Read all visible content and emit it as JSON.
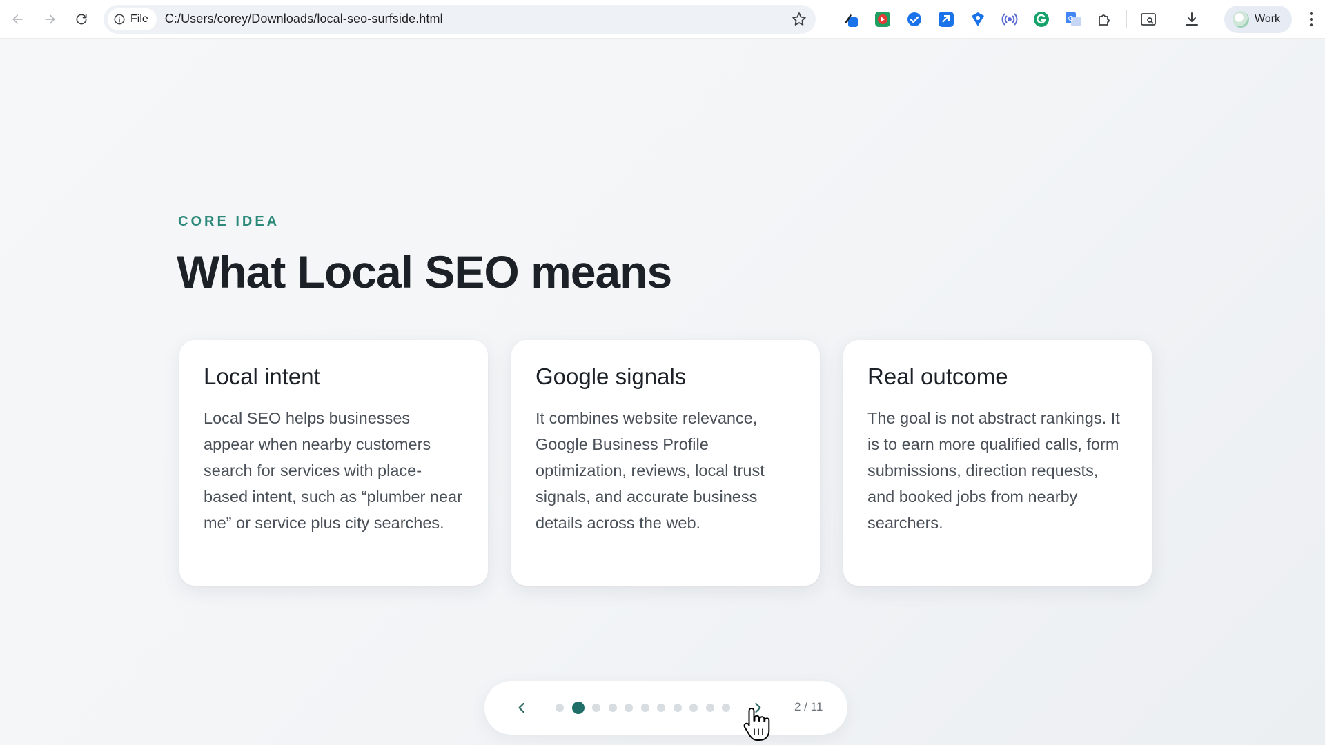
{
  "browser": {
    "site_chip": "File",
    "url": "C:/Users/corey/Downloads/local-seo-surfside.html",
    "profile_label": "Work",
    "extensions": [
      "pen-extension-icon",
      "video-record-extension-icon",
      "check-extension-icon",
      "tag-extension-icon",
      "shield-arrow-extension-icon",
      "broadcast-extension-icon",
      "grammarly-icon",
      "translate-icon",
      "puzzle-icon"
    ]
  },
  "slide": {
    "eyebrow": "CORE IDEA",
    "title": "What Local SEO means",
    "cards": [
      {
        "heading": "Local intent",
        "body": "Local SEO helps businesses appear when nearby customers search for services with place-based intent, such as “plumber near me” or service plus city searches."
      },
      {
        "heading": "Google signals",
        "body": "It combines website relevance, Google Business Profile optimization, reviews, local trust signals, and accurate business details across the web."
      },
      {
        "heading": "Real outcome",
        "body": "The goal is not abstract rankings. It is to earn more qualified calls, form submissions, direction requests, and booked jobs from nearby searchers."
      }
    ]
  },
  "pager": {
    "counter": "2 / 11",
    "total_slides": 11,
    "current_slide": 2
  },
  "colors": {
    "accent": "#2d8a7a",
    "active_dot": "#1f6e68",
    "title": "#1c2128"
  }
}
